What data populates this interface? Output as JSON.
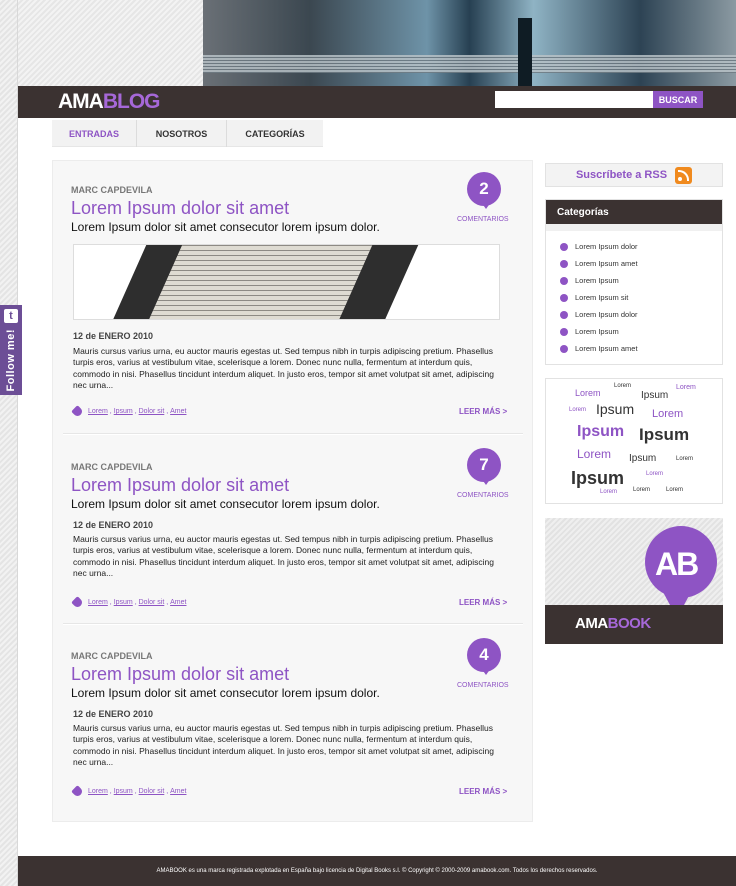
{
  "brand": {
    "logo_part1": "AMA",
    "logo_part2": "BLOG"
  },
  "search": {
    "placeholder": "",
    "button_label": "BUSCAR"
  },
  "nav": {
    "items": [
      {
        "label": "ENTRADAS"
      },
      {
        "label": "NOSOTROS"
      },
      {
        "label": "CATEGORÍAS"
      }
    ],
    "active": "ENTRADAS"
  },
  "follow": {
    "label": "Follow me!",
    "icon": "t"
  },
  "posts": [
    {
      "author": "MARC CAPDEVILA",
      "title": "Lorem Ipsum dolor sit amet",
      "subtitle": "Lorem Ipsum dolor sit amet consecutor lorem ipsum dolor.",
      "comments_count": "2",
      "comments_label": "COMENTARIOS",
      "date": "12 de ENERO 2010",
      "body": "Mauris cursus varius urna, eu auctor mauris egestas ut. Sed tempus nibh in turpis adipiscing pretium. Phasellus turpis eros, varius at vestibulum vitae, scelerisque a lorem. Donec nunc nulla, fermentum at interdum quis, commodo in nisi. Phasellus tincidunt interdum aliquet. In justo eros, tempor sit amet volutpat sit amet, adipiscing nec urna...",
      "tags": [
        "Lorem",
        "Ipsum",
        "Dolor sit",
        "Amet"
      ],
      "read_more": "LEER MÁS >",
      "has_image": true
    },
    {
      "author": "MARC CAPDEVILA",
      "title": "Lorem Ipsum dolor sit amet",
      "subtitle": "Lorem Ipsum dolor sit amet consecutor lorem ipsum dolor.",
      "comments_count": "7",
      "comments_label": "COMENTARIOS",
      "date": "12 de ENERO 2010",
      "body": "Mauris cursus varius urna, eu auctor mauris egestas ut. Sed tempus nibh in turpis adipiscing pretium. Phasellus turpis eros, varius at vestibulum vitae, scelerisque a lorem. Donec nunc nulla, fermentum at interdum quis, commodo in nisi. Phasellus tincidunt interdum aliquet. In justo eros, tempor sit amet volutpat sit amet, adipiscing nec urna...",
      "tags": [
        "Lorem",
        "Ipsum",
        "Dolor sit",
        "Amet"
      ],
      "read_more": "LEER MÁS >",
      "has_image": false
    },
    {
      "author": "MARC CAPDEVILA",
      "title": "Lorem Ipsum dolor sit amet",
      "subtitle": "Lorem Ipsum dolor sit amet consecutor lorem ipsum dolor.",
      "comments_count": "4",
      "comments_label": "COMENTARIOS",
      "date": "12 de ENERO 2010",
      "body": "Mauris cursus varius urna, eu auctor mauris egestas ut. Sed tempus nibh in turpis adipiscing pretium. Phasellus turpis eros, varius at vestibulum vitae, scelerisque a lorem. Donec nunc nulla, fermentum at interdum quis, commodo in nisi. Phasellus tincidunt interdum aliquet. In justo eros, tempor sit amet volutpat sit amet, adipiscing nec urna...",
      "tags": [
        "Lorem",
        "Ipsum",
        "Dolor sit",
        "Amet"
      ],
      "read_more": "LEER MÁS >",
      "has_image": false
    }
  ],
  "sidebar": {
    "rss_label": "Suscríbete a RSS",
    "categories_title": "Categorías",
    "categories": [
      "Lorem Ipsum dolor",
      "Lorem Ipsum amet",
      "Lorem Ipsum",
      "Lorem Ipsum sit",
      "Lorem Ipsum dolor",
      "Lorem Ipsum",
      "Lorem Ipsum amet"
    ],
    "tag_cloud": [
      "Lorem",
      "Lorem",
      "Ipsum",
      "Lorem",
      "Lorem",
      "Ipsum",
      "Lorem",
      "Ipsum",
      "Ipsum",
      "Lorem",
      "Ipsum",
      "Lorem",
      "Ipsum",
      "Lorem",
      "Lorem",
      "Lorem",
      "Lorem"
    ],
    "ad": {
      "logo_part1": "AMA",
      "logo_part2": "BOOK",
      "badge": "AB"
    }
  },
  "footer": {
    "text": "AMABOOK es una marca registrada explotada en España bajo licencia de Digital Books s.l. © Copyright © 2000-2009 amabook.com. Todos los derechos reservados."
  },
  "colors": {
    "accent": "#8e54c4",
    "dark": "#3b3231",
    "rss": "#f08a1e"
  }
}
